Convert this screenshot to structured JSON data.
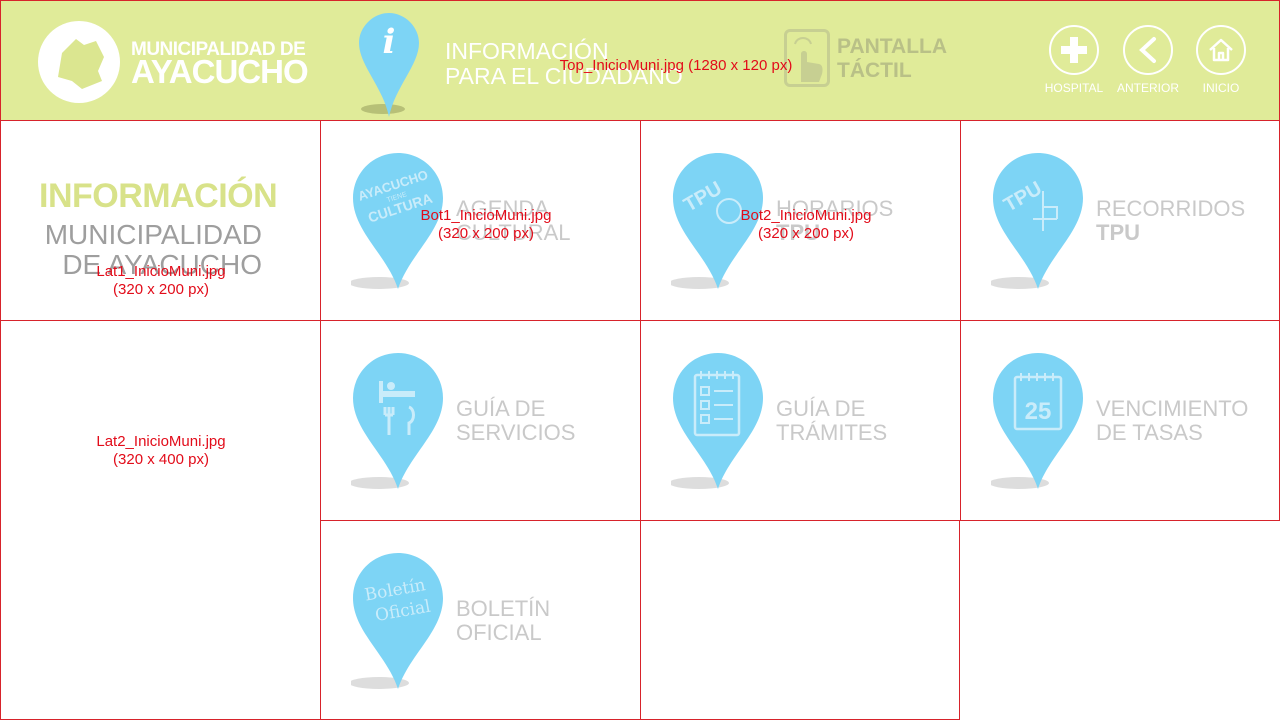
{
  "header": {
    "logo_line1": "MUNICIPALIDAD DE",
    "logo_line2": "AYACUCHO",
    "title_line1": "INFORMACIÓN",
    "title_line2": "PARA EL CIUDADANO",
    "touch_line1": "PANTALLA",
    "touch_line2": "TÁCTIL",
    "overlay": "Top_InicioMuni.jpg (1280 x 120 px)"
  },
  "nav": {
    "hospital": "HOSPITAL",
    "anterior": "ANTERIOR",
    "inicio": "INICIO"
  },
  "sidebar": {
    "title1": "INFORMACIÓN",
    "title2": "MUNICIPALIDAD",
    "title3": "DE AYACUCHO",
    "lat1_overlay1": "Lat1_InicioMuni.jpg",
    "lat1_overlay2": "(320 x 200 px)",
    "lat2_overlay1": "Lat2_InicioMuni.jpg",
    "lat2_overlay2": "(320 x 400 px)"
  },
  "tiles": [
    {
      "line1": "AGENDA",
      "line2": "CULTURAL",
      "icon": "ayacucho-cultura-icon",
      "overlay1": "Bot1_InicioMuni.jpg",
      "overlay2": "(320 x 200 px)",
      "pin_text1": "AYACUCHO",
      "pin_text2": "TIENE",
      "pin_text3": "CULTURA"
    },
    {
      "line1": "HORARIOS",
      "line2": "TPU",
      "icon": "tpu-clock-icon",
      "overlay1": "Bot2_InicioMuni.jpg",
      "overlay2": "(320 x 200 px)",
      "pin_text1": "TPU"
    },
    {
      "line1": "RECORRIDOS",
      "line2": "TPU",
      "icon": "tpu-route-icon",
      "pin_text1": "TPU"
    },
    {
      "line1": "GUÍA DE",
      "line2": "SERVICIOS",
      "icon": "bed-fork-knife-icon"
    },
    {
      "line1": "GUÍA DE",
      "line2": "TRÁMITES",
      "icon": "checklist-icon"
    },
    {
      "line1": "VENCIMIENTO",
      "line2": "DE TASAS",
      "icon": "calendar-icon",
      "pin_text1": "25"
    },
    {
      "line1": "BOLETÍN",
      "line2": "OFICIAL",
      "icon": "boletin-icon",
      "pin_text1": "Boletín",
      "pin_text2": "Oficial"
    }
  ],
  "colors": {
    "header_bg": "#e0eb99",
    "grid_border": "#d7232b",
    "pin_blue": "#7dd4f5",
    "overlay_text": "#e20c1a"
  }
}
